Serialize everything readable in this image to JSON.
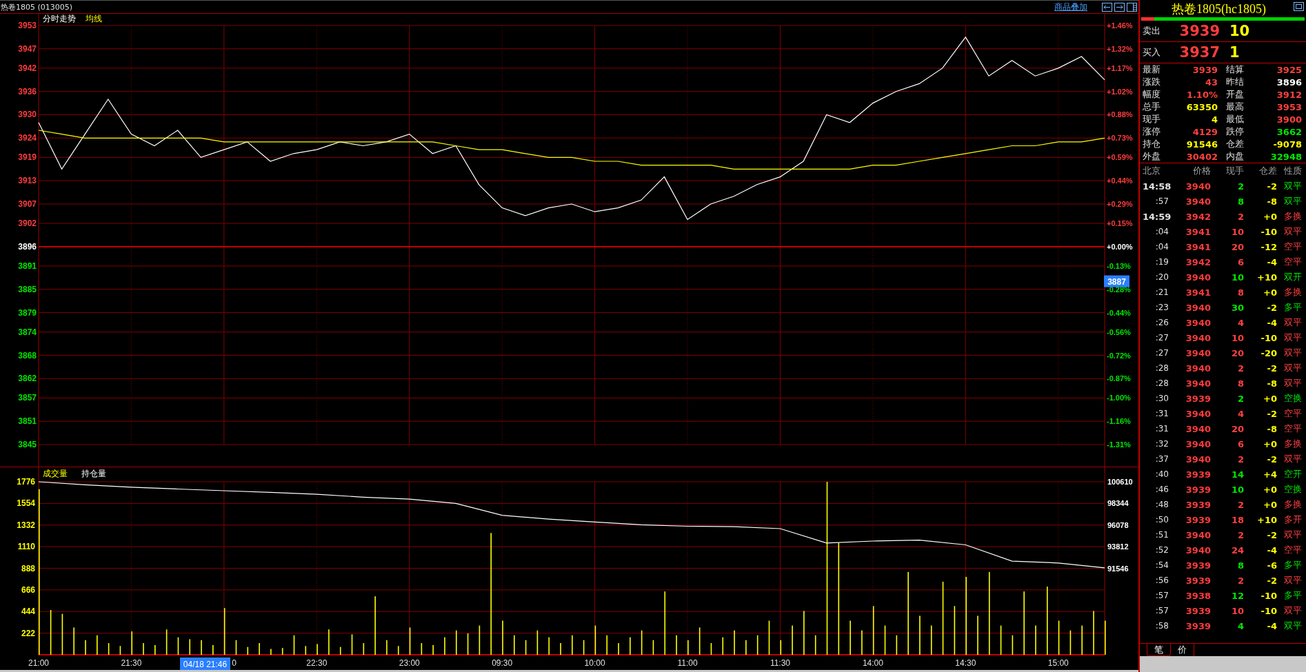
{
  "title_bar": {
    "title": "热卷1805 (013005)",
    "overlay_link": "商品叠加"
  },
  "price_chart": {
    "cursor_price": "3887",
    "right_axis_labels": [
      {
        "text": "+1.46%",
        "color": "#ff3c3c"
      },
      {
        "text": "+1.32%",
        "color": "#ff3c3c"
      },
      {
        "text": "+1.17%",
        "color": "#ff3c3c"
      },
      {
        "text": "+1.02%",
        "color": "#ff3c3c"
      },
      {
        "text": "+0.88%",
        "color": "#ff3c3c"
      },
      {
        "text": "+0.73%",
        "color": "#ff3c3c"
      },
      {
        "text": "+0.59%",
        "color": "#ff3c3c"
      },
      {
        "text": "+0.44%",
        "color": "#ff3c3c"
      },
      {
        "text": "+0.29%",
        "color": "#ff3c3c"
      },
      {
        "text": "+0.15%",
        "color": "#ff3c3c"
      },
      {
        "text": "+0.00%",
        "color": "#ffffff"
      },
      {
        "text": "-0.13%",
        "color": "#00e600"
      },
      {
        "text": "-0.28%",
        "color": "#00e600"
      },
      {
        "text": "-0.44%",
        "color": "#00e600"
      },
      {
        "text": "-0.56%",
        "color": "#00e600"
      },
      {
        "text": "-0.72%",
        "color": "#00e600"
      },
      {
        "text": "-0.87%",
        "color": "#00e600"
      },
      {
        "text": "-1.00%",
        "color": "#00e600"
      },
      {
        "text": "-1.16%",
        "color": "#00e600"
      },
      {
        "text": "-1.31%",
        "color": "#00e600"
      }
    ],
    "chart_data": {
      "type": "line",
      "grid": true,
      "ylim": [
        3845,
        3953
      ],
      "ref_lines": [
        {
          "axis": "y",
          "value": 3896
        }
      ],
      "yticks": [
        {
          "value": 3953,
          "label": "3953"
        },
        {
          "value": 3947,
          "label": "3947"
        },
        {
          "value": 3942,
          "label": "3942"
        },
        {
          "value": 3936,
          "label": "3936"
        },
        {
          "value": 3930,
          "label": "3930"
        },
        {
          "value": 3924,
          "label": "3924"
        },
        {
          "value": 3919,
          "label": "3919"
        },
        {
          "value": 3913,
          "label": "3913"
        },
        {
          "value": 3907,
          "label": "3907"
        },
        {
          "value": 3902,
          "label": "3902"
        },
        {
          "value": 3896,
          "label": "3896"
        },
        {
          "value": 3891,
          "label": "3891"
        },
        {
          "value": 3885,
          "label": "3885"
        },
        {
          "value": 3879,
          "label": "3879"
        },
        {
          "value": 3874,
          "label": "3874"
        },
        {
          "value": 3868,
          "label": "3868"
        },
        {
          "value": 3862,
          "label": "3862"
        },
        {
          "value": 3857,
          "label": "3857"
        },
        {
          "value": 3851,
          "label": "3851"
        },
        {
          "value": 3845,
          "label": "3845"
        }
      ],
      "series": [
        {
          "name": "分时走势",
          "color": "#ffffff",
          "values": [
            3928,
            3916,
            3925,
            3934,
            3925,
            3922,
            3926,
            3919,
            3921,
            3923,
            3918,
            3920,
            3921,
            3923,
            3922,
            3923,
            3925,
            3920,
            3922,
            3912,
            3906,
            3904,
            3906,
            3907,
            3905,
            3906,
            3908,
            3914,
            3903,
            3907,
            3909,
            3912,
            3914,
            3918,
            3930,
            3928,
            3933,
            3936,
            3938,
            3942,
            3950,
            3940,
            3944,
            3940,
            3942,
            3945,
            3939
          ]
        },
        {
          "name": "均线",
          "color": "#ffff00",
          "values": [
            3926,
            3925,
            3924,
            3924,
            3924,
            3924,
            3924,
            3924,
            3923,
            3923,
            3923,
            3923,
            3923,
            3923,
            3923,
            3923,
            3923,
            3923,
            3922,
            3921,
            3921,
            3920,
            3919,
            3919,
            3918,
            3918,
            3917,
            3917,
            3917,
            3917,
            3916,
            3916,
            3916,
            3916,
            3916,
            3916,
            3917,
            3917,
            3918,
            3919,
            3920,
            3921,
            3922,
            3922,
            3923,
            3923,
            3924
          ]
        }
      ]
    }
  },
  "volume_chart": {
    "cursor_time": "04/18 21:46",
    "time_axis_labels": [
      {
        "text": "21:00",
        "kind": "full"
      },
      {
        "text": "21:30",
        "kind": "full"
      },
      {
        "text": "0",
        "kind": "partial"
      },
      {
        "text": "22:30",
        "kind": "full"
      },
      {
        "text": "23:00",
        "kind": "full"
      },
      {
        "text": "09:30",
        "kind": "full"
      },
      {
        "text": "10:00",
        "kind": "full"
      },
      {
        "text": "11:00",
        "kind": "full"
      },
      {
        "text": "11:30",
        "kind": "full"
      },
      {
        "text": "14:00",
        "kind": "full"
      },
      {
        "text": "14:30",
        "kind": "full"
      },
      {
        "text": "15:00",
        "kind": "full"
      }
    ],
    "chart_data": {
      "type": "bar",
      "grid": true,
      "ylim": [
        0,
        1776
      ],
      "yticks": [
        1776,
        1554,
        1332,
        1110,
        888,
        666,
        444,
        222
      ],
      "series": [
        {
          "name": "成交量",
          "color": "#ffff00",
          "values": [
            1700,
            460,
            420,
            280,
            150,
            200,
            120,
            90,
            240,
            120,
            100,
            260,
            180,
            160,
            150,
            100,
            480,
            150,
            80,
            120,
            60,
            70,
            200,
            90,
            110,
            260,
            80,
            210,
            120,
            600,
            150,
            90,
            280,
            120,
            100,
            180,
            250,
            220,
            300,
            1250,
            350,
            200,
            150,
            250,
            180,
            120,
            200,
            150,
            300,
            200,
            120,
            180,
            250,
            150,
            650,
            200,
            150,
            280,
            120,
            180,
            250,
            150,
            200,
            350,
            150,
            300,
            450,
            200,
            1776,
            1150,
            350,
            250,
            500,
            300,
            200,
            850,
            400,
            300,
            750,
            500,
            800,
            400,
            850,
            300,
            200,
            650,
            300,
            700,
            350,
            250,
            300,
            450,
            350
          ]
        }
      ]
    },
    "open_interest": {
      "chart_data": {
        "type": "line",
        "ylim": [
          82482,
          100610
        ],
        "yticks": [
          100610,
          98344,
          96078,
          93812,
          91546
        ],
        "series": [
          {
            "name": "持仓量",
            "color": "#ffffff",
            "values": [
              100610,
              100300,
              100050,
              99850,
              99670,
              99500,
              99300,
              99000,
              98800,
              98350,
              97100,
              96700,
              96400,
              96100,
              95950,
              95900,
              95700,
              94200,
              94400,
              94500,
              94000,
              92300,
              92100,
              91600
            ]
          }
        ]
      }
    }
  },
  "quote": {
    "title": "热卷1805(hc1805)",
    "ratio_bar": {
      "level": 0.08
    },
    "ask": {
      "label": "卖出",
      "price": "3939",
      "volume": "10"
    },
    "bid": {
      "label": "买入",
      "price": "3937",
      "volume": "1"
    },
    "stats": [
      {
        "label": "最新",
        "value": "3939",
        "color": "#ff4040"
      },
      {
        "label": "结算",
        "value": "3925",
        "color": "#ff4040"
      },
      {
        "label": "涨跌",
        "value": "43",
        "color": "#ff4040"
      },
      {
        "label": "昨结",
        "value": "3896",
        "color": "#ffffff"
      },
      {
        "label": "幅度",
        "value": "1.10%",
        "color": "#ff4040"
      },
      {
        "label": "开盘",
        "value": "3912",
        "color": "#ff4040"
      },
      {
        "label": "总手",
        "value": "63350",
        "color": "#ffff00"
      },
      {
        "label": "最高",
        "value": "3953",
        "color": "#ff4040"
      },
      {
        "label": "现手",
        "value": "4",
        "color": "#ffff00"
      },
      {
        "label": "最低",
        "value": "3900",
        "color": "#ff4040"
      },
      {
        "label": "涨停",
        "value": "4129",
        "color": "#ff4040"
      },
      {
        "label": "跌停",
        "value": "3662",
        "color": "#00e600"
      },
      {
        "label": "持仓",
        "value": "91546",
        "color": "#ffff00"
      },
      {
        "label": "仓差",
        "value": "-9078",
        "color": "#ffff00"
      },
      {
        "label": "外盘",
        "value": "30402",
        "color": "#ff4040"
      },
      {
        "label": "内盘",
        "value": "32948",
        "color": "#00e600"
      }
    ],
    "ticks_header": [
      "北京",
      "价格",
      "现手",
      "仓差",
      "性质"
    ],
    "ticks": [
      {
        "time": "14:58",
        "price": "3940",
        "volume": "2",
        "oi_change": "-2",
        "nature": "双平",
        "kind": "down",
        "full_time": true
      },
      {
        "time": ":57",
        "price": "3940",
        "volume": "8",
        "oi_change": "-8",
        "nature": "双平",
        "kind": "down",
        "full_time": false
      },
      {
        "time": "14:59",
        "price": "3942",
        "volume": "2",
        "oi_change": "+0",
        "nature": "多换",
        "kind": "up",
        "full_time": true
      },
      {
        "time": ":04",
        "price": "3941",
        "volume": "10",
        "oi_change": "-10",
        "nature": "双平",
        "kind": "up",
        "full_time": false
      },
      {
        "time": ":04",
        "price": "3941",
        "volume": "20",
        "oi_change": "-12",
        "nature": "空平",
        "kind": "up",
        "full_time": false
      },
      {
        "time": ":19",
        "price": "3942",
        "volume": "6",
        "oi_change": "-4",
        "nature": "空平",
        "kind": "up",
        "full_time": false
      },
      {
        "time": ":20",
        "price": "3940",
        "volume": "10",
        "oi_change": "+10",
        "nature": "双开",
        "kind": "down",
        "full_time": false
      },
      {
        "time": ":21",
        "price": "3941",
        "volume": "8",
        "oi_change": "+0",
        "nature": "多换",
        "kind": "up",
        "full_time": false
      },
      {
        "time": ":23",
        "price": "3940",
        "volume": "30",
        "oi_change": "-2",
        "nature": "多平",
        "kind": "down",
        "full_time": false
      },
      {
        "time": ":26",
        "price": "3940",
        "volume": "4",
        "oi_change": "-4",
        "nature": "双平",
        "kind": "up",
        "full_time": false
      },
      {
        "time": ":27",
        "price": "3940",
        "volume": "10",
        "oi_change": "-10",
        "nature": "双平",
        "kind": "up",
        "full_time": false
      },
      {
        "time": ":27",
        "price": "3940",
        "volume": "20",
        "oi_change": "-20",
        "nature": "双平",
        "kind": "up",
        "full_time": false
      },
      {
        "time": ":28",
        "price": "3940",
        "volume": "2",
        "oi_change": "-2",
        "nature": "双平",
        "kind": "up",
        "full_time": false
      },
      {
        "time": ":28",
        "price": "3940",
        "volume": "8",
        "oi_change": "-8",
        "nature": "双平",
        "kind": "up",
        "full_time": false
      },
      {
        "time": ":30",
        "price": "3939",
        "volume": "2",
        "oi_change": "+0",
        "nature": "空换",
        "kind": "down",
        "full_time": false
      },
      {
        "time": ":31",
        "price": "3940",
        "volume": "4",
        "oi_change": "-2",
        "nature": "空平",
        "kind": "up",
        "full_time": false
      },
      {
        "time": ":31",
        "price": "3940",
        "volume": "20",
        "oi_change": "-8",
        "nature": "空平",
        "kind": "up",
        "full_time": false
      },
      {
        "time": ":32",
        "price": "3940",
        "volume": "6",
        "oi_change": "+0",
        "nature": "多换",
        "kind": "up",
        "full_time": false
      },
      {
        "time": ":37",
        "price": "3940",
        "volume": "2",
        "oi_change": "-2",
        "nature": "双平",
        "kind": "up",
        "full_time": false
      },
      {
        "time": ":40",
        "price": "3939",
        "volume": "14",
        "oi_change": "+4",
        "nature": "空开",
        "kind": "down",
        "full_time": false
      },
      {
        "time": ":46",
        "price": "3939",
        "volume": "10",
        "oi_change": "+0",
        "nature": "空换",
        "kind": "down",
        "full_time": false
      },
      {
        "time": ":48",
        "price": "3939",
        "volume": "2",
        "oi_change": "+0",
        "nature": "多换",
        "kind": "up",
        "full_time": false
      },
      {
        "time": ":50",
        "price": "3939",
        "volume": "18",
        "oi_change": "+10",
        "nature": "多开",
        "kind": "up",
        "full_time": false
      },
      {
        "time": ":51",
        "price": "3940",
        "volume": "2",
        "oi_change": "-2",
        "nature": "双平",
        "kind": "up",
        "full_time": false
      },
      {
        "time": ":52",
        "price": "3940",
        "volume": "24",
        "oi_change": "-4",
        "nature": "空平",
        "kind": "up",
        "full_time": false
      },
      {
        "time": ":54",
        "price": "3939",
        "volume": "8",
        "oi_change": "-6",
        "nature": "多平",
        "kind": "down",
        "full_time": false
      },
      {
        "time": ":56",
        "price": "3939",
        "volume": "2",
        "oi_change": "-2",
        "nature": "双平",
        "kind": "up",
        "full_time": false
      },
      {
        "time": ":57",
        "price": "3938",
        "volume": "12",
        "oi_change": "-10",
        "nature": "多平",
        "kind": "down",
        "full_time": false
      },
      {
        "time": ":57",
        "price": "3939",
        "volume": "10",
        "oi_change": "-10",
        "nature": "双平",
        "kind": "up",
        "full_time": false
      },
      {
        "time": ":58",
        "price": "3939",
        "volume": "4",
        "oi_change": "-4",
        "nature": "双平",
        "kind": "down",
        "full_time": false
      }
    ],
    "tabs": [
      {
        "label": "笔",
        "selected": true
      },
      {
        "label": "价",
        "selected": false
      }
    ]
  }
}
